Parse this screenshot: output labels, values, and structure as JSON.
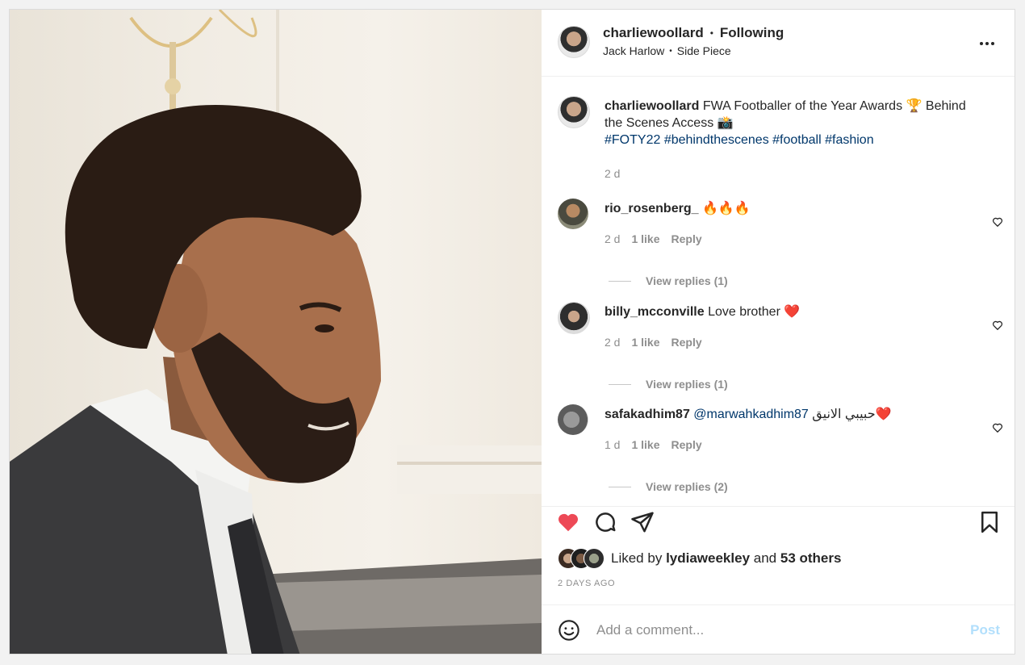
{
  "header": {
    "username": "charliewoollard",
    "separator": "•",
    "follow_status": "Following",
    "audio_artist": "Jack Harlow",
    "audio_sep": "•",
    "audio_track": "Side Piece"
  },
  "caption": {
    "username": "charliewoollard",
    "text_line1": "FWA Footballer of the Year Awards 🏆 Behind",
    "text_line2": "the Scenes Access 📸",
    "hashtags": [
      "#FOTY22",
      "#behindthescenes",
      "#football",
      "#fashion"
    ],
    "time": "2 d"
  },
  "comments": [
    {
      "username": "rio_rosenberg_",
      "text": "🔥🔥🔥",
      "time": "2 d",
      "likes": "1 like",
      "reply": "Reply",
      "view_replies": "View replies (1)"
    },
    {
      "username": "billy_mcconville",
      "text": "Love brother ❤️",
      "time": "2 d",
      "likes": "1 like",
      "reply": "Reply",
      "view_replies": "View replies (1)"
    },
    {
      "username": "safakadhim87",
      "mention": "@marwahkadhim87",
      "text": "حبيبي الانيق❤️",
      "time": "1 d",
      "likes": "1 like",
      "reply": "Reply",
      "view_replies": "View replies (2)"
    }
  ],
  "likes": {
    "prefix": "Liked by",
    "user": "lydiaweekley",
    "conj": "and",
    "others": "53 others"
  },
  "post_date": "2 DAYS AGO",
  "add_comment": {
    "placeholder": "Add a comment...",
    "post_label": "Post"
  },
  "colors": {
    "like_red": "#ed4956",
    "link_blue": "#00376b",
    "post_disabled": "#b2dffc"
  },
  "icons": [
    "more-options-icon",
    "heart-icon",
    "comment-icon",
    "share-icon",
    "bookmark-icon",
    "emoji-icon"
  ]
}
